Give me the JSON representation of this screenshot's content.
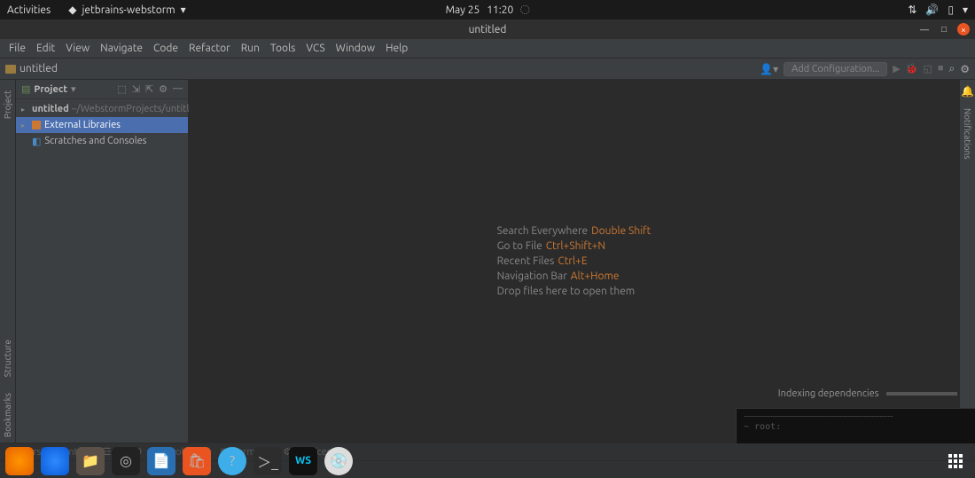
{
  "gnome": {
    "activities": "Activities",
    "app": "jetbrains-webstorm",
    "date": "May 25",
    "time": "11:20"
  },
  "window": {
    "title": "untitled"
  },
  "menu": [
    "File",
    "Edit",
    "View",
    "Navigate",
    "Code",
    "Refactor",
    "Run",
    "Tools",
    "VCS",
    "Window",
    "Help"
  ],
  "breadcrumb": {
    "project": "untitled"
  },
  "run": {
    "add_config": "Add Configuration..."
  },
  "project_tw": {
    "title": "Project",
    "tree": {
      "root": "untitled",
      "root_path": "~/WebstormProjects/untitled",
      "external": "External Libraries",
      "scratches": "Scratches and Consoles"
    }
  },
  "left_tabs": [
    "Project",
    "Structure",
    "Bookmarks"
  ],
  "right_tabs": [
    "Notifications"
  ],
  "hints": [
    {
      "label": "Search Everywhere",
      "key": "Double Shift"
    },
    {
      "label": "Go to File",
      "key": "Ctrl+Shift+N"
    },
    {
      "label": "Recent Files",
      "key": "Ctrl+E"
    },
    {
      "label": "Navigation Bar",
      "key": "Alt+Home"
    },
    {
      "label": "Drop files here to open them",
      "key": ""
    }
  ],
  "bottom": {
    "vcs": "Version Control",
    "todo": "TODO",
    "problems": "Problems",
    "terminal": "Terminal",
    "services": "Services"
  },
  "status": {
    "indexing": "Indexing dependencies",
    "root": "~ root:"
  }
}
